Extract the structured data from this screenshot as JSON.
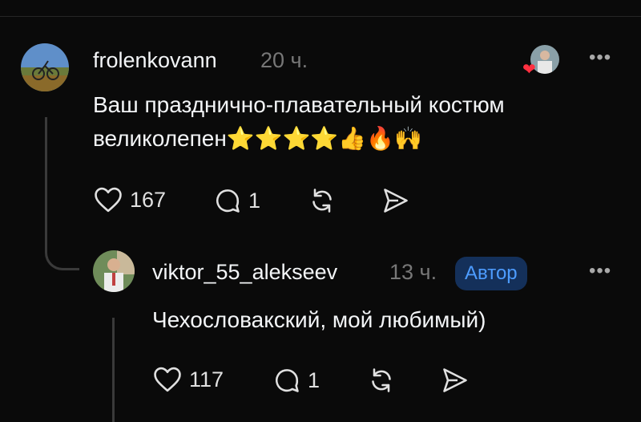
{
  "comment": {
    "username": "frolenkovann",
    "time": "20 ч.",
    "text_line1": "Ваш празднично-плавательный костюм",
    "text_line2": "великолепен⭐⭐⭐⭐👍🔥🙌",
    "likes": "167",
    "replies": "1"
  },
  "reply": {
    "username": "viktor_55_alekseev",
    "time": "13 ч.",
    "badge": "Автор",
    "text": "Чехословакский, мой любимый)",
    "likes": "117",
    "replies": "1"
  },
  "icons": [
    "heart-icon",
    "comment-icon",
    "repost-icon",
    "share-icon",
    "more-icon"
  ]
}
